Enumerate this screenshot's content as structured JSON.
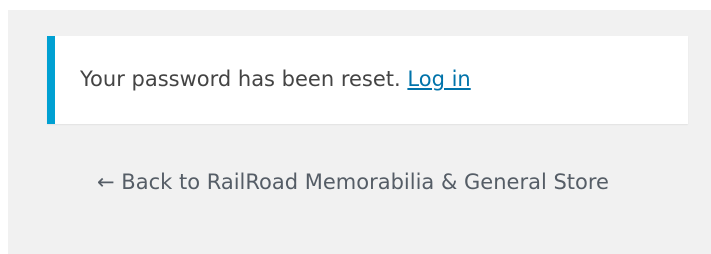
{
  "notice": {
    "message": "Your password has been reset.",
    "login_link": "Log in",
    "accent_color": "#00a0d2",
    "link_color": "#0073aa"
  },
  "back_link": {
    "arrow": "←",
    "label": "Back to RailRoad Memorabilia & General Store"
  },
  "colors": {
    "background": "#f1f1f1",
    "text": "#444444",
    "muted_text": "#555d66"
  }
}
